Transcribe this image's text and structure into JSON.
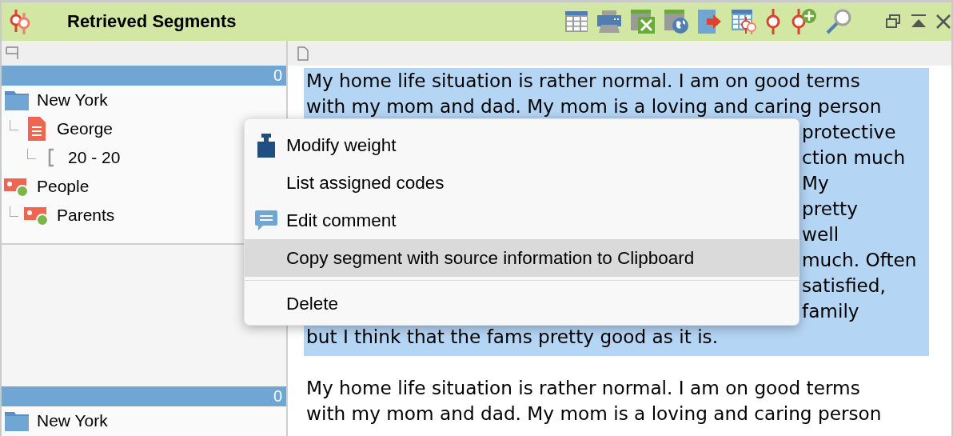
{
  "window": {
    "title": "Retrieved Segments"
  },
  "groups": [
    {
      "count": "0",
      "tree": [
        {
          "kind": "folder",
          "label": "New York",
          "children": [
            {
              "kind": "document",
              "label": "George",
              "children": [
                {
                  "kind": "segment",
                  "label": "20 - 20"
                }
              ]
            }
          ]
        },
        {
          "kind": "code",
          "label": "People",
          "children": [
            {
              "kind": "code",
              "label": "Parents"
            }
          ]
        }
      ]
    },
    {
      "count": "0",
      "tree": [
        {
          "kind": "folder",
          "label": "New York"
        }
      ]
    }
  ],
  "segments": [
    {
      "selected": true,
      "lines": [
        {
          "kind": "full",
          "text": "My home life situation is rather normal. I am on good terms"
        },
        {
          "kind": "full",
          "text": "with my mom and dad. My mom is a loving and caring person"
        },
        {
          "kind": "tail",
          "text": "protective"
        },
        {
          "kind": "tail",
          "text": "ction much"
        },
        {
          "kind": "tail",
          "text": "My"
        },
        {
          "kind": "tail",
          "text": "pretty"
        },
        {
          "kind": "tail",
          "text": "well"
        },
        {
          "kind": "tail",
          "text": "much. Often"
        },
        {
          "kind": "tail",
          "text": "satisfied,"
        },
        {
          "kind": "tail",
          "text": "family"
        },
        {
          "kind": "full",
          "text": "but I think that the fams pretty good as it is."
        }
      ]
    },
    {
      "selected": false,
      "lines": [
        {
          "kind": "full",
          "text": "My home life situation is rather normal. I am on good terms"
        },
        {
          "kind": "full",
          "text": "with my mom and dad. My mom is a loving and caring person"
        }
      ]
    }
  ],
  "context_menu": {
    "items": [
      {
        "kind": "item",
        "label": "Modify weight",
        "selected": false
      },
      {
        "kind": "item",
        "label": "List assigned codes",
        "selected": false
      },
      {
        "kind": "item",
        "label": "Edit comment",
        "selected": false
      },
      {
        "kind": "item",
        "label": "Copy segment with source information to Clipboard",
        "selected": true
      },
      {
        "kind": "separator"
      },
      {
        "kind": "item",
        "label": "Delete",
        "selected": false
      }
    ]
  }
}
